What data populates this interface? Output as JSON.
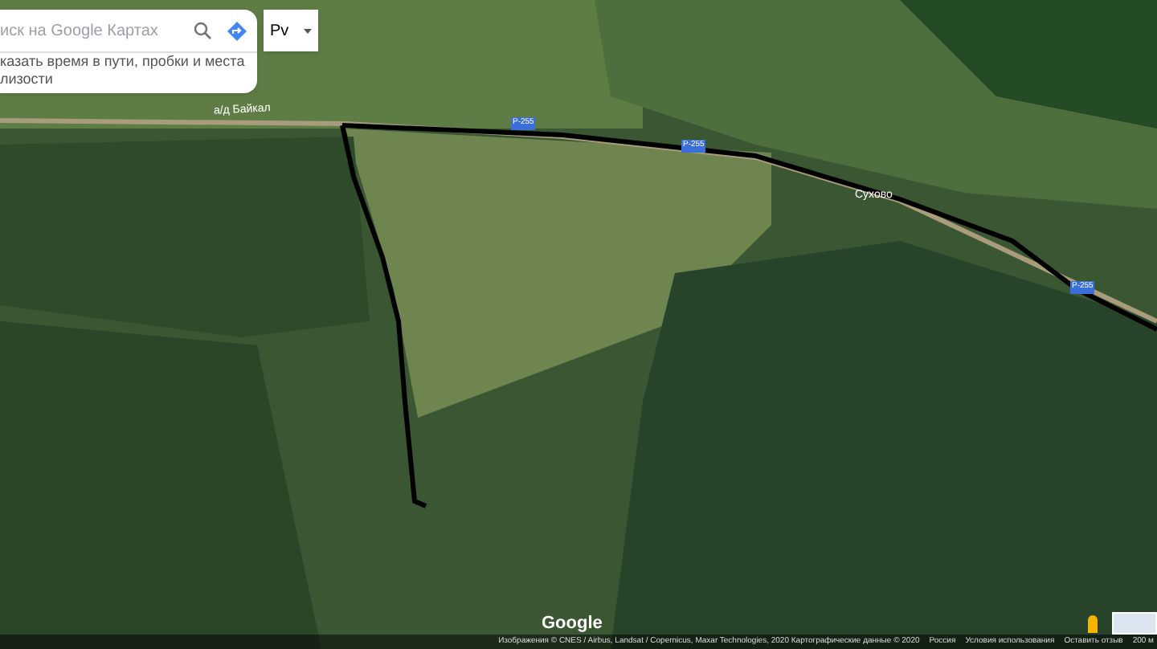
{
  "search": {
    "placeholder": "иск на Google Картах",
    "hint": "казать время в пути, пробки и места\nлизости"
  },
  "layer_button": {
    "label": "Рv"
  },
  "map_labels": [
    {
      "kind": "road",
      "text": "а/д Байкал"
    },
    {
      "kind": "shield",
      "text": "Р-255"
    },
    {
      "kind": "shield",
      "text": "Р-255"
    },
    {
      "kind": "place",
      "text": "Сухово"
    },
    {
      "kind": "shield",
      "text": "Р-255"
    }
  ],
  "logo": "Google",
  "footer": [
    "Изображения © CNES / Airbus, Landsat / Copernicus, Maxar Technologies, 2020 Картографические данные © 2020",
    "Россия",
    "Условия использования",
    "Оставить отзыв",
    "200 м"
  ]
}
